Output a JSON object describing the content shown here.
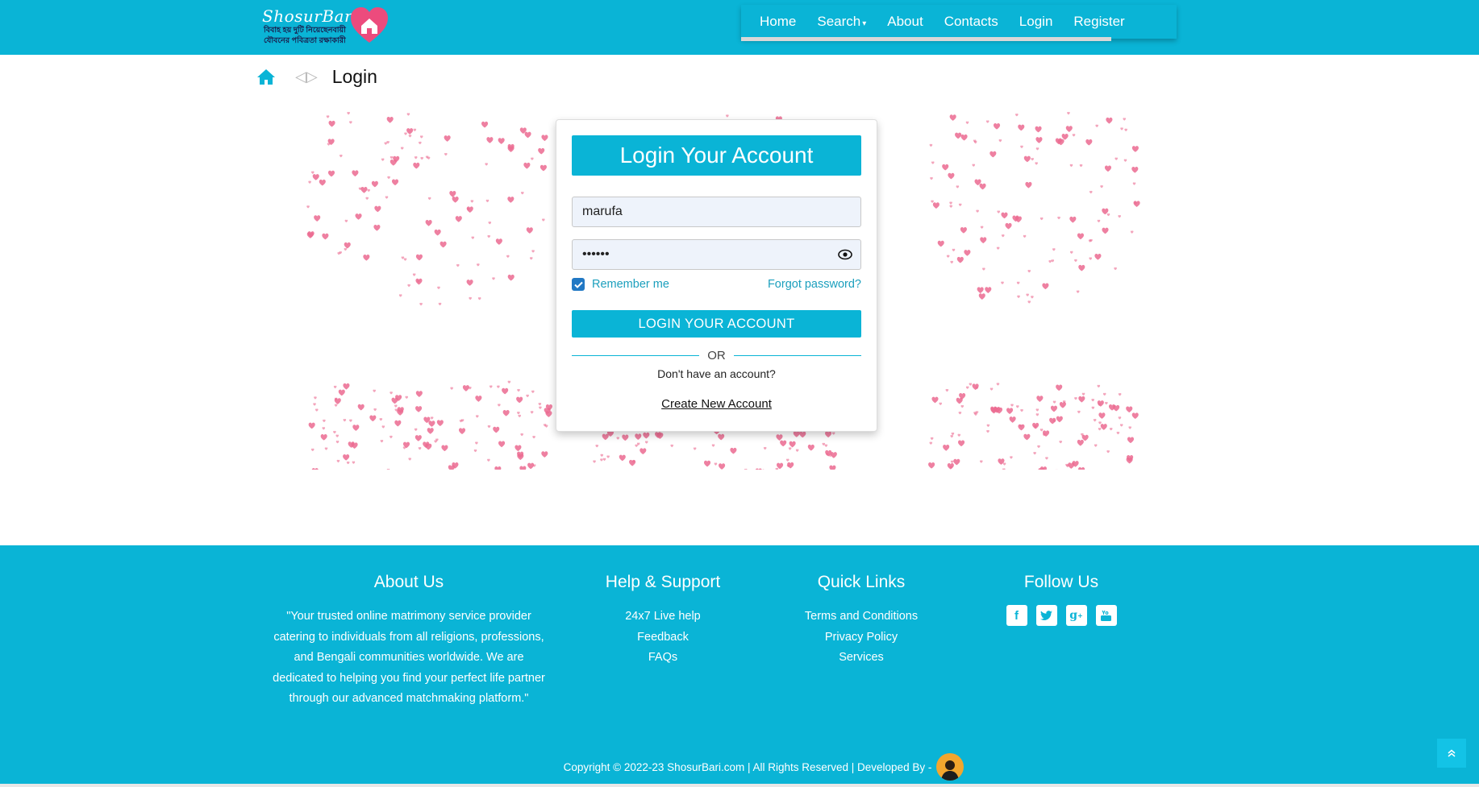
{
  "brand": {
    "name": "ShosurBari",
    "tagline_line1": "বিবাহ হয় দুটি নিয়েছেনবায়ী",
    "tagline_line2": "যৌবনের পবিত্রতা রক্ষাকারী",
    "accent_color": "#0ab4d6"
  },
  "nav": {
    "items": [
      "Home",
      "Search",
      "About",
      "Contacts",
      "Login",
      "Register"
    ]
  },
  "breadcrumb": {
    "home_icon": "home-icon",
    "separator": "◁▷",
    "current": "Login"
  },
  "login": {
    "title": "Login Your Account",
    "username_value": "marufa",
    "password_value": "••••••",
    "remember_label": "Remember me",
    "remember_checked": true,
    "forgot_label": "Forgot password?",
    "submit_label": "LOGIN YOUR ACCOUNT",
    "or_label": "OR",
    "no_account_text": "Don't have an account?",
    "create_label": "Create New Account"
  },
  "footer": {
    "about": {
      "heading": "About Us",
      "text": "\"Your trusted online matrimony service provider catering to individuals from all religions, professions, and Bengali communities worldwide. We are dedicated to helping you find your perfect life partner through our advanced matchmaking platform.\""
    },
    "help": {
      "heading": "Help & Support",
      "links": [
        "24x7 Live help",
        "Feedback",
        "FAQs"
      ]
    },
    "quick": {
      "heading": "Quick Links",
      "links": [
        "Terms and Conditions",
        "Privacy Policy",
        "Services"
      ]
    },
    "follow": {
      "heading": "Follow Us",
      "icons": [
        "facebook-icon",
        "twitter-icon",
        "google-plus-icon",
        "youtube-icon"
      ]
    },
    "copyright": "Copyright © 2022-23 ShosurBari.com | All Rights Reserved | Developed By -"
  }
}
